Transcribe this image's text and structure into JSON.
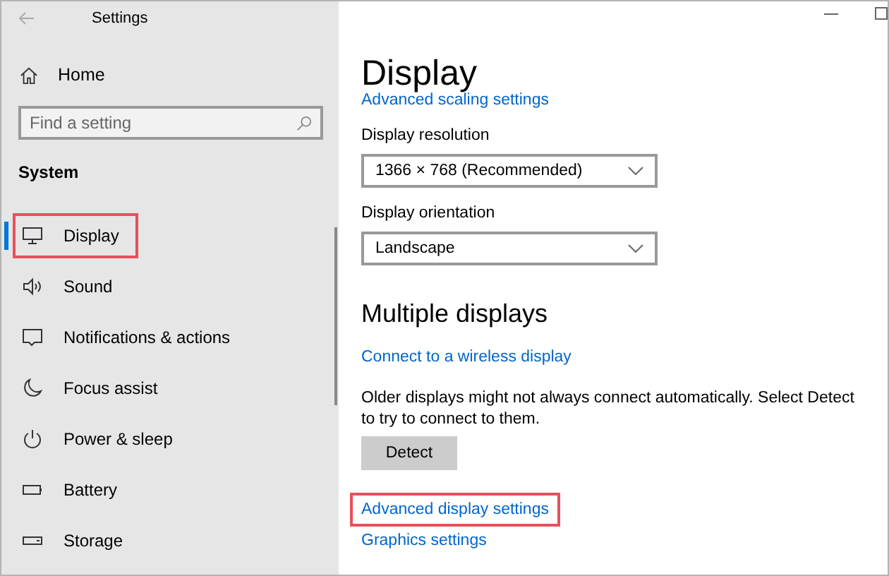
{
  "window": {
    "title": "Settings"
  },
  "sidebar": {
    "home": "Home",
    "search": {
      "placeholder": "Find a setting"
    },
    "section": "System",
    "items": [
      {
        "label": "Display",
        "selected": true,
        "highlighted": true
      },
      {
        "label": "Sound",
        "selected": false,
        "highlighted": false
      },
      {
        "label": "Notifications & actions",
        "selected": false,
        "highlighted": false
      },
      {
        "label": "Focus assist",
        "selected": false,
        "highlighted": false
      },
      {
        "label": "Power & sleep",
        "selected": false,
        "highlighted": false
      },
      {
        "label": "Battery",
        "selected": false,
        "highlighted": false
      },
      {
        "label": "Storage",
        "selected": false,
        "highlighted": false
      }
    ]
  },
  "content": {
    "title": "Display",
    "scaling_link": "Advanced scaling settings",
    "dropdowns": [
      {
        "label": "Display resolution",
        "value": "1366 × 768 (Recommended)"
      },
      {
        "label": "Display orientation",
        "value": "Landscape"
      }
    ],
    "section": "Multiple displays",
    "wireless_link": "Connect to a wireless display",
    "description": "Older displays might not always connect automatically. Select Detect to try to connect to them.",
    "detect_button": "Detect",
    "links": [
      {
        "label": "Advanced display settings",
        "highlighted": true
      },
      {
        "label": "Graphics settings",
        "highlighted": false
      }
    ]
  }
}
